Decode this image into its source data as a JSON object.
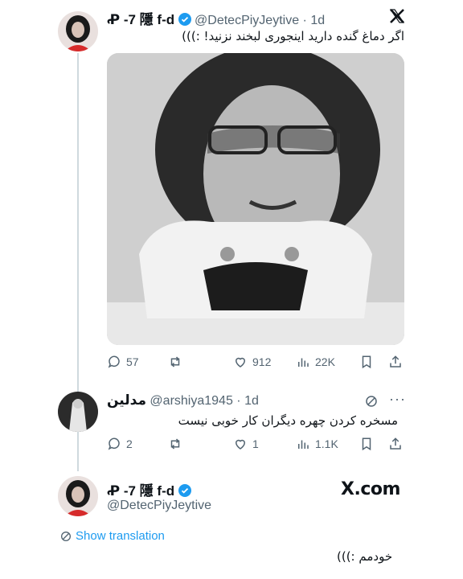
{
  "tweet": {
    "author_name": "Ꝓ -7 隱 f-d",
    "handle": "@DetecPiyJeytive",
    "time": "· 1d",
    "text": "اگر دماغ گنده دارید اینجوری لبخند نزنید! :)))",
    "actions": {
      "replies": "57",
      "retweets": "",
      "likes": "912",
      "views": "22K"
    }
  },
  "reply": {
    "author_name": "مدلین",
    "handle": "@arshiya1945",
    "time": "· 1d",
    "text": "مسخره کردن چهره دیگران کار خوبی نیست",
    "actions": {
      "replies": "2",
      "retweets": "",
      "likes": "1",
      "views": "1.1K"
    }
  },
  "bottom": {
    "author_name": "Ꝓ -7 隱 f-d",
    "handle": "@DetecPiyJeytive",
    "brand": "X.com",
    "show_translation": "Show translation",
    "text": "خودمم :)))"
  },
  "colors": {
    "blue": "#1d9bf0",
    "gray": "#536471",
    "line": "#cfd9de"
  }
}
